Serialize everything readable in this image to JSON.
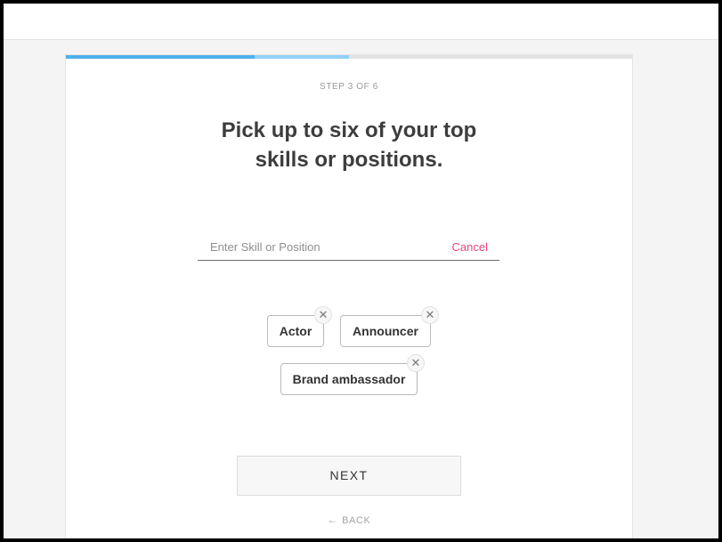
{
  "wizard": {
    "step_label": "STEP 3 OF 6",
    "current_step": 3,
    "total_steps": 6,
    "title_line1": "Pick up to six of your top",
    "title_line2": "skills or positions."
  },
  "search": {
    "placeholder": "Enter Skill or Position",
    "value": "",
    "cancel_label": "Cancel"
  },
  "selected_skills": [
    {
      "label": "Actor",
      "remove_icon": "close-icon"
    },
    {
      "label": "Announcer",
      "remove_icon": "close-icon"
    },
    {
      "label": "Brand ambassador",
      "remove_icon": "close-icon"
    }
  ],
  "actions": {
    "next_label": "NEXT",
    "back_label": "BACK",
    "back_icon": "arrow-left-icon"
  },
  "colors": {
    "accent_pink": "#e8457c",
    "progress_done": "#4db0ec",
    "progress_current": "#92d0f5"
  }
}
